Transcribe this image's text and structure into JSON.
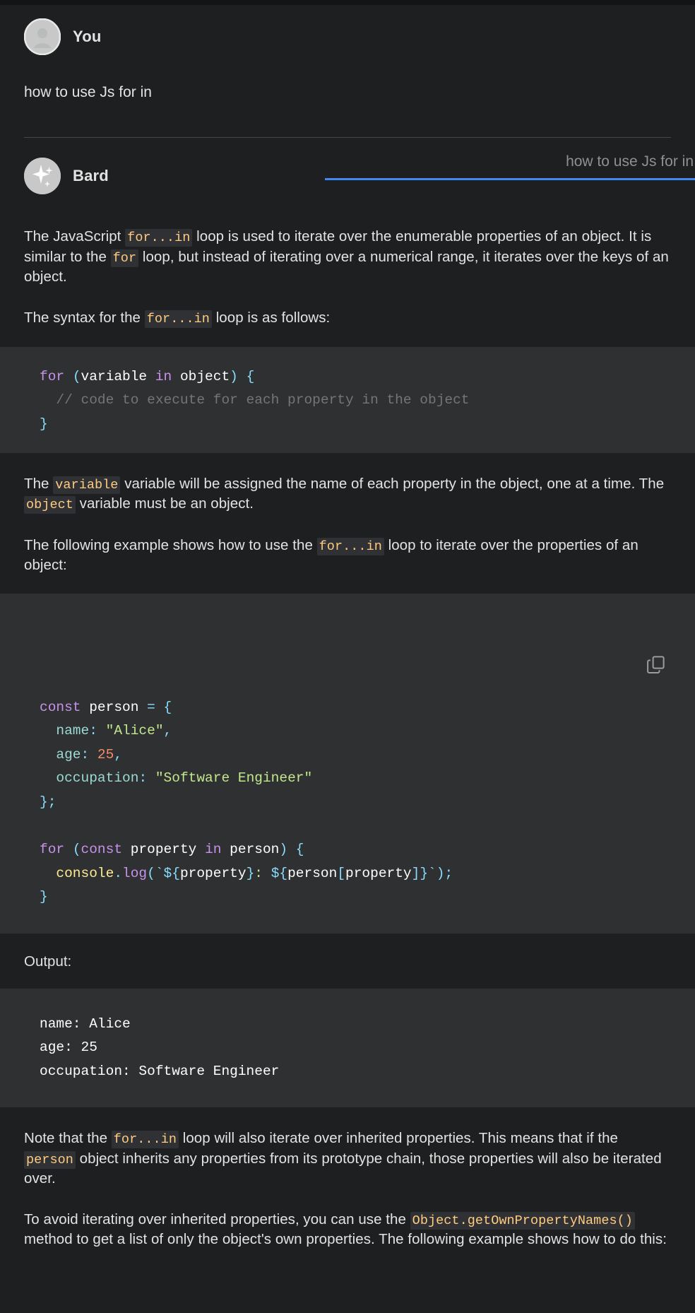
{
  "window": {
    "background": "#1e1f20"
  },
  "accent": {
    "blue": "#4285f4",
    "inline_code": "#ffcc80"
  },
  "user": {
    "author": "You",
    "avatar_icon": "person-avatar-icon",
    "message": "how to use Js for in"
  },
  "bard": {
    "author": "Bard",
    "avatar_icon": "sparkle-icon",
    "draft_selector": {
      "selected": "how to use Js for in",
      "caret_icon": "chevron-down-icon"
    }
  },
  "content": {
    "p1": {
      "parts": [
        {
          "type": "text",
          "value": "The JavaScript "
        },
        {
          "type": "code",
          "value": "for...in"
        },
        {
          "type": "text",
          "value": " loop is used to iterate over the enumerable properties of an object. It is similar to the "
        },
        {
          "type": "code",
          "value": "for"
        },
        {
          "type": "text",
          "value": " loop, but instead of iterating over a numerical range, it iterates over the keys of an object."
        }
      ]
    },
    "p2": {
      "parts": [
        {
          "type": "text",
          "value": "The syntax for the "
        },
        {
          "type": "code",
          "value": "for...in"
        },
        {
          "type": "text",
          "value": " loop is as follows:"
        }
      ]
    },
    "p3": {
      "parts": [
        {
          "type": "text",
          "value": "The "
        },
        {
          "type": "code",
          "value": "variable"
        },
        {
          "type": "text",
          "value": " variable will be assigned the name of each property in the object, one at a time. The "
        },
        {
          "type": "code",
          "value": "object"
        },
        {
          "type": "text",
          "value": " variable must be an object."
        }
      ]
    },
    "p4": {
      "parts": [
        {
          "type": "text",
          "value": "The following example shows how to use the "
        },
        {
          "type": "code",
          "value": "for...in"
        },
        {
          "type": "text",
          "value": " loop to iterate over the properties of an object:"
        }
      ]
    },
    "output_label": "Output:",
    "p5": {
      "parts": [
        {
          "type": "text",
          "value": "Note that the "
        },
        {
          "type": "code",
          "value": "for...in"
        },
        {
          "type": "text",
          "value": " loop will also iterate over inherited properties. This means that if the "
        },
        {
          "type": "code",
          "value": "person"
        },
        {
          "type": "text",
          "value": " object inherits any properties from its prototype chain, those properties will also be iterated over."
        }
      ]
    },
    "p6": {
      "parts": [
        {
          "type": "text",
          "value": "To avoid iterating over inherited properties, you can use the "
        },
        {
          "type": "code",
          "value": "Object.getOwnPropertyNames()"
        },
        {
          "type": "text",
          "value": " method to get a list of only the object's own properties. The following example shows how to do this:"
        }
      ]
    }
  },
  "code_block_1": {
    "language": "javascript",
    "plain_text": "for (variable in object) {\n  // code to execute for each property in the object\n}",
    "lines": [
      [
        {
          "t": "kw",
          "v": "for"
        },
        {
          "t": "plain",
          "v": " "
        },
        {
          "t": "pun",
          "v": "("
        },
        {
          "t": "var",
          "v": "variable"
        },
        {
          "t": "plain",
          "v": " "
        },
        {
          "t": "kw",
          "v": "in"
        },
        {
          "t": "plain",
          "v": " "
        },
        {
          "t": "var",
          "v": "object"
        },
        {
          "t": "pun",
          "v": ")"
        },
        {
          "t": "plain",
          "v": " "
        },
        {
          "t": "pun",
          "v": "{"
        }
      ],
      [
        {
          "t": "cmt",
          "v": "  // code to execute for each property in the object"
        }
      ],
      [
        {
          "t": "pun",
          "v": "}"
        }
      ]
    ]
  },
  "code_block_2": {
    "language": "javascript",
    "copy_button": {
      "icon": "copy-icon",
      "tooltip": "Copy code"
    },
    "plain_text": "const person = {\n  name: \"Alice\",\n  age: 25,\n  occupation: \"Software Engineer\"\n};\n\nfor (const property in person) {\n  console.log(`${property}: ${person[property]}`);\n}",
    "lines": [
      [
        {
          "t": "kw",
          "v": "const"
        },
        {
          "t": "plain",
          "v": " "
        },
        {
          "t": "var",
          "v": "person"
        },
        {
          "t": "plain",
          "v": " "
        },
        {
          "t": "op",
          "v": "="
        },
        {
          "t": "plain",
          "v": " "
        },
        {
          "t": "pun",
          "v": "{"
        }
      ],
      [
        {
          "t": "plain",
          "v": "  "
        },
        {
          "t": "prop",
          "v": "name"
        },
        {
          "t": "pun",
          "v": ":"
        },
        {
          "t": "plain",
          "v": " "
        },
        {
          "t": "str",
          "v": "\"Alice\""
        },
        {
          "t": "pun",
          "v": ","
        }
      ],
      [
        {
          "t": "plain",
          "v": "  "
        },
        {
          "t": "prop",
          "v": "age"
        },
        {
          "t": "pun",
          "v": ":"
        },
        {
          "t": "plain",
          "v": " "
        },
        {
          "t": "num",
          "v": "25"
        },
        {
          "t": "pun",
          "v": ","
        }
      ],
      [
        {
          "t": "plain",
          "v": "  "
        },
        {
          "t": "prop",
          "v": "occupation"
        },
        {
          "t": "pun",
          "v": ":"
        },
        {
          "t": "plain",
          "v": " "
        },
        {
          "t": "str",
          "v": "\"Software Engineer\""
        }
      ],
      [
        {
          "t": "pun",
          "v": "}"
        },
        {
          "t": "pun",
          "v": ";"
        }
      ],
      [
        {
          "t": "plain",
          "v": ""
        }
      ],
      [
        {
          "t": "kw",
          "v": "for"
        },
        {
          "t": "plain",
          "v": " "
        },
        {
          "t": "pun",
          "v": "("
        },
        {
          "t": "kw",
          "v": "const"
        },
        {
          "t": "plain",
          "v": " "
        },
        {
          "t": "var",
          "v": "property"
        },
        {
          "t": "plain",
          "v": " "
        },
        {
          "t": "kw",
          "v": "in"
        },
        {
          "t": "plain",
          "v": " "
        },
        {
          "t": "var",
          "v": "person"
        },
        {
          "t": "pun",
          "v": ")"
        },
        {
          "t": "plain",
          "v": " "
        },
        {
          "t": "pun",
          "v": "{"
        }
      ],
      [
        {
          "t": "plain",
          "v": "  "
        },
        {
          "t": "obj",
          "v": "console"
        },
        {
          "t": "pun",
          "v": "."
        },
        {
          "t": "fn",
          "v": "log"
        },
        {
          "t": "pun",
          "v": "("
        },
        {
          "t": "op",
          "v": "`"
        },
        {
          "t": "op",
          "v": "${"
        },
        {
          "t": "var",
          "v": "property"
        },
        {
          "t": "op",
          "v": "}"
        },
        {
          "t": "str",
          "v": ":"
        },
        {
          "t": "plain",
          "v": " "
        },
        {
          "t": "op",
          "v": "${"
        },
        {
          "t": "var",
          "v": "person"
        },
        {
          "t": "pun",
          "v": "["
        },
        {
          "t": "var",
          "v": "property"
        },
        {
          "t": "pun",
          "v": "]"
        },
        {
          "t": "op",
          "v": "}"
        },
        {
          "t": "op",
          "v": "`"
        },
        {
          "t": "pun",
          "v": ")"
        },
        {
          "t": "pun",
          "v": ";"
        }
      ],
      [
        {
          "t": "pun",
          "v": "}"
        }
      ]
    ]
  },
  "code_block_3": {
    "language": "text",
    "plain_text": "name: Alice\nage: 25\noccupation: Software Engineer",
    "lines": [
      [
        {
          "t": "plain",
          "v": "name: Alice"
        }
      ],
      [
        {
          "t": "plain",
          "v": "age: 25"
        }
      ],
      [
        {
          "t": "plain",
          "v": "occupation: Software Engineer"
        }
      ]
    ]
  }
}
